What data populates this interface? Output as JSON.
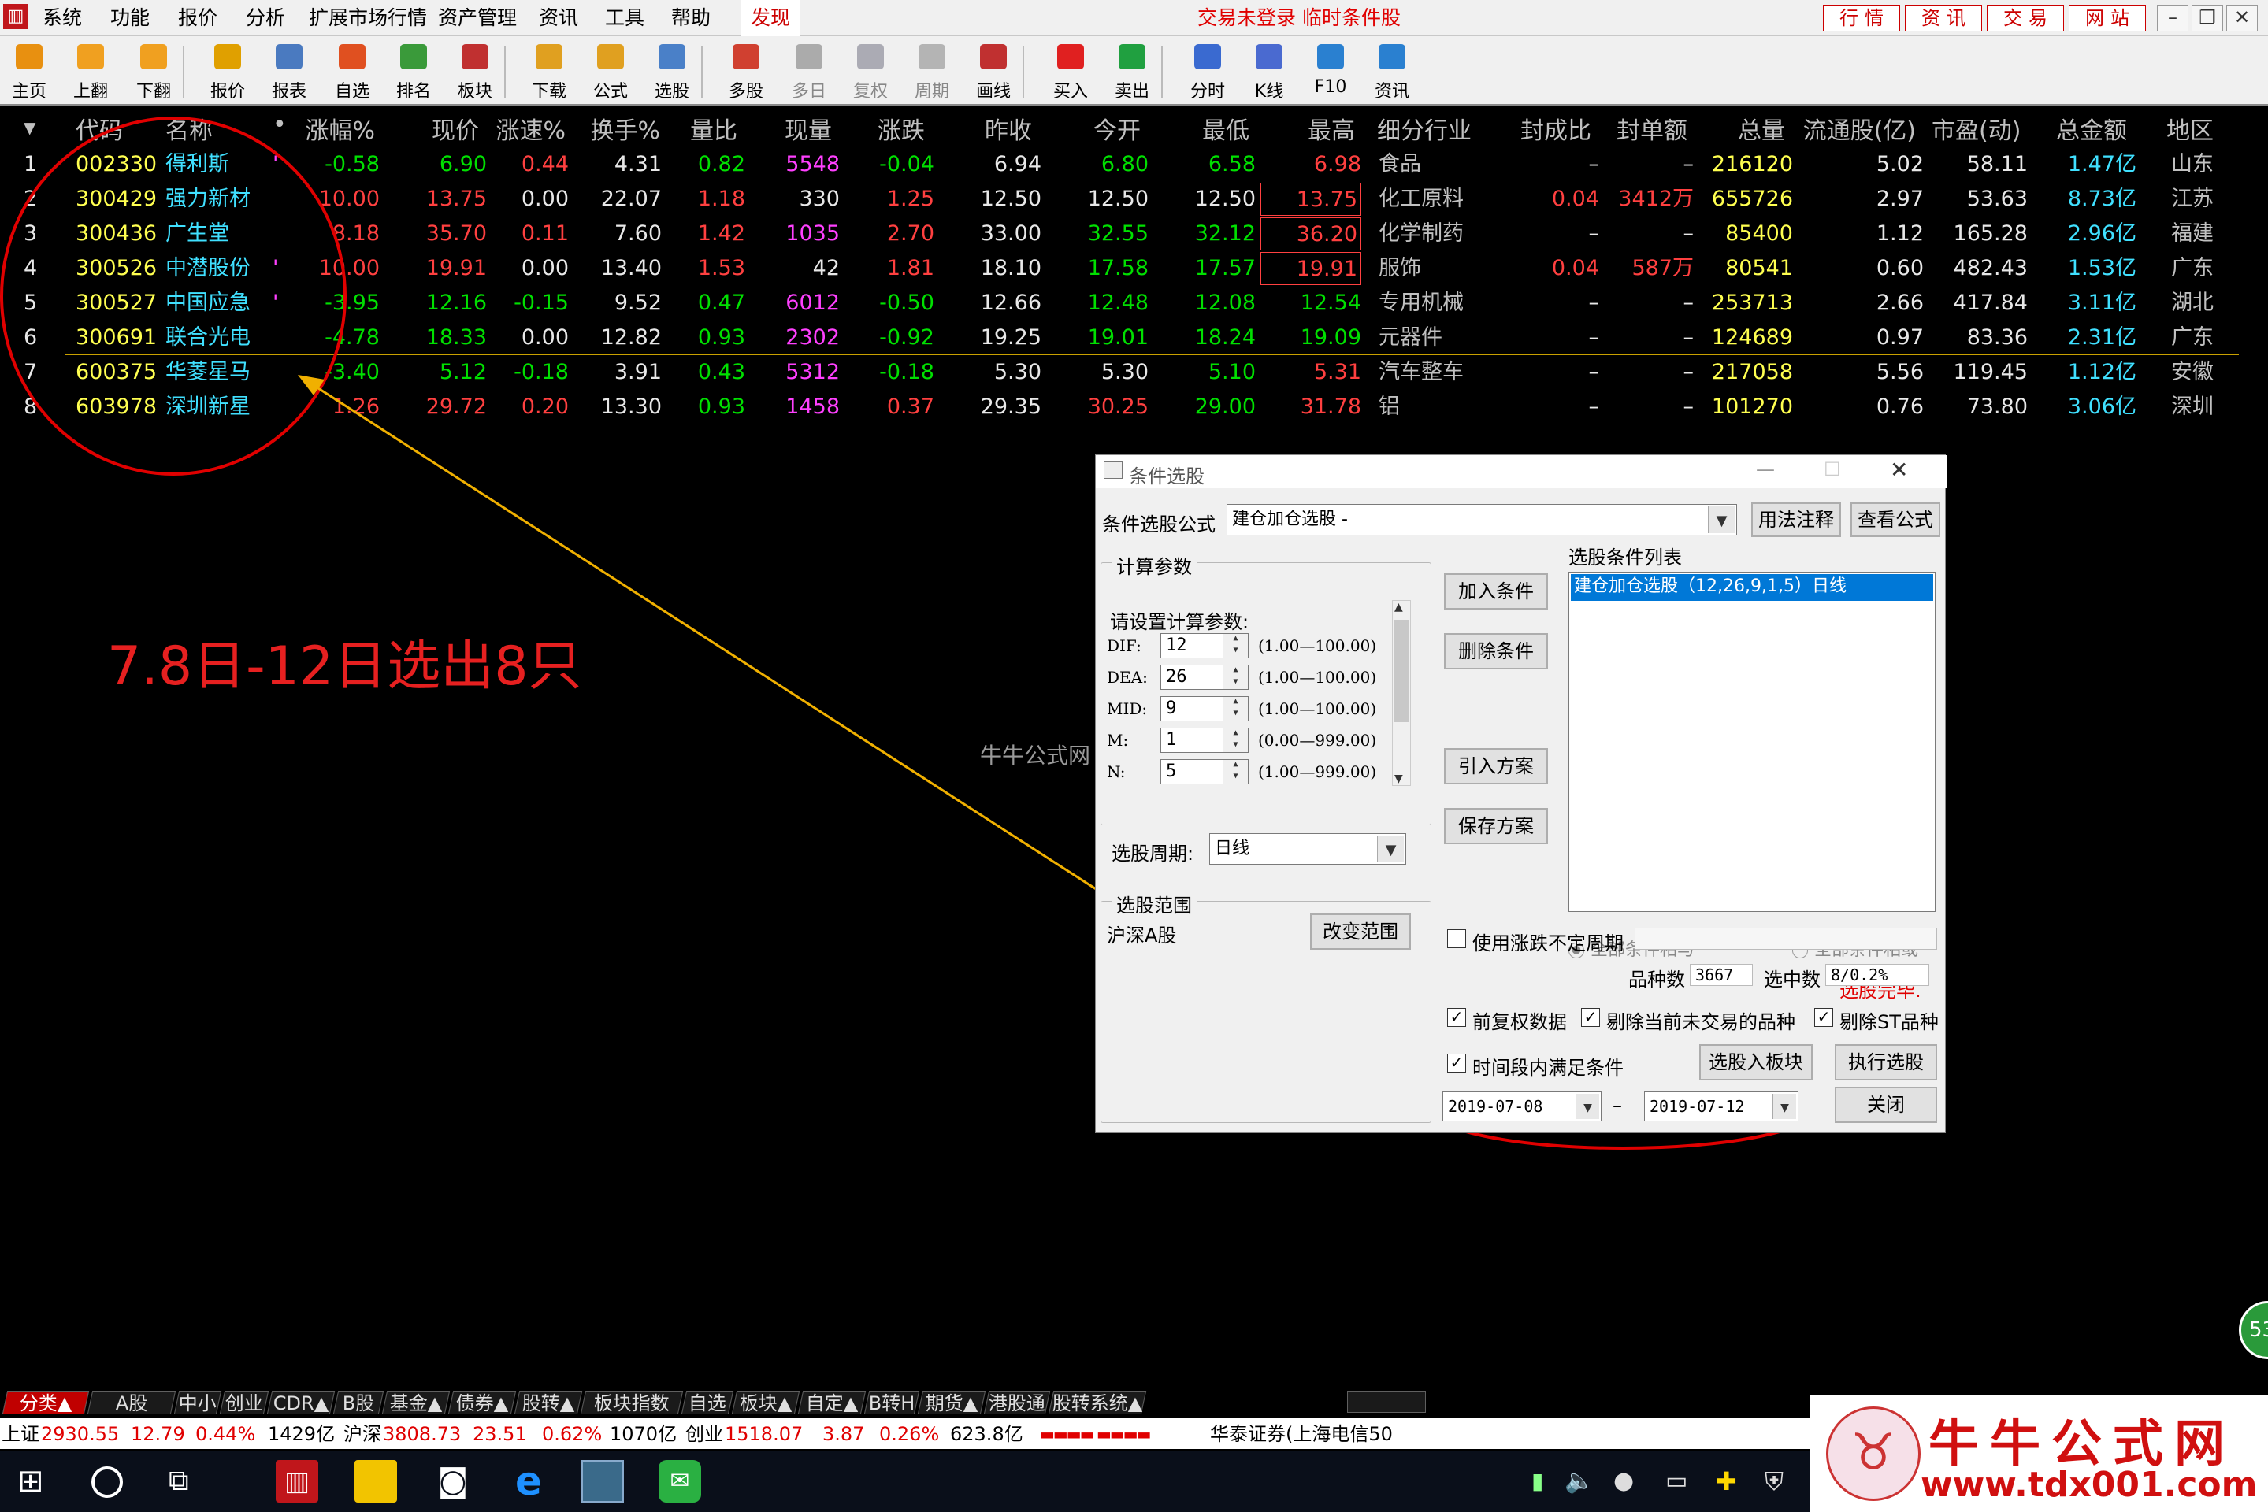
{
  "menu": {
    "items": [
      "系统",
      "功能",
      "报价",
      "分析",
      "扩展市场行情",
      "资产管理",
      "资讯",
      "工具",
      "帮助"
    ],
    "found": "发现",
    "login_status": "交易未登录  临时条件股",
    "toplinks": [
      "行情",
      "资讯",
      "交易",
      "网站"
    ]
  },
  "toolbar": {
    "buttons": [
      {
        "label": "主页",
        "icon": "home-icon"
      },
      {
        "label": "上翻",
        "icon": "page-up-icon"
      },
      {
        "label": "下翻",
        "icon": "page-down-icon"
      },
      {
        "label": "报价",
        "icon": "quote-icon"
      },
      {
        "label": "报表",
        "icon": "report-icon"
      },
      {
        "label": "自选",
        "icon": "watchlist-icon"
      },
      {
        "label": "排名",
        "icon": "ranking-icon"
      },
      {
        "label": "板块",
        "icon": "sector-icon"
      },
      {
        "label": "下载",
        "icon": "download-icon"
      },
      {
        "label": "公式",
        "icon": "formula-icon"
      },
      {
        "label": "选股",
        "icon": "stock-picker-icon"
      },
      {
        "label": "多股",
        "icon": "multi-stock-icon"
      },
      {
        "label": "多日",
        "icon": "multi-day-icon"
      },
      {
        "label": "复权",
        "icon": "adjust-icon"
      },
      {
        "label": "周期",
        "icon": "period-icon"
      },
      {
        "label": "画线",
        "icon": "draw-line-icon"
      },
      {
        "label": "买入",
        "icon": "buy-icon"
      },
      {
        "label": "卖出",
        "icon": "sell-icon"
      },
      {
        "label": "分时",
        "icon": "intraday-icon"
      },
      {
        "label": "K线",
        "icon": "kline-icon"
      },
      {
        "label": "F10",
        "icon": "f10-icon"
      },
      {
        "label": "资讯",
        "icon": "news-icon"
      }
    ]
  },
  "table": {
    "headers": [
      "代码",
      "名称",
      "•",
      "涨幅%",
      "现价",
      "涨速%",
      "换手%",
      "量比",
      "现量",
      "涨跌",
      "昨收",
      "今开",
      "最低",
      "最高",
      "细分行业",
      "封成比",
      "封单额",
      "总量",
      "流通股(亿)",
      "市盈(动)",
      "总金额",
      "地区"
    ],
    "rows": [
      {
        "no": "1",
        "code": "002330",
        "name": "得利斯",
        "dot": "'",
        "pct": "-0.58",
        "price": "6.90",
        "speed": "0.44",
        "turnover": "4.31",
        "vratio": "0.82",
        "vol": "5548",
        "chg": "-0.04",
        "prev": "6.94",
        "open": "6.80",
        "low": "6.58",
        "high": "6.98",
        "industry": "食品",
        "sealratio": "–",
        "sealamt": "–",
        "total": "216120",
        "float": "5.02",
        "pe": "58.11",
        "amount": "1.47亿",
        "region": "山东"
      },
      {
        "no": "2",
        "code": "300429",
        "name": "强力新材",
        "dot": "",
        "pct": "10.00",
        "price": "13.75",
        "speed": "0.00",
        "turnover": "22.07",
        "vratio": "1.18",
        "vol": "330",
        "chg": "1.25",
        "prev": "12.50",
        "open": "12.50",
        "low": "12.50",
        "high": "13.75",
        "industry": "化工原料",
        "sealratio": "0.04",
        "sealamt": "3412万",
        "total": "655726",
        "float": "2.97",
        "pe": "53.63",
        "amount": "8.73亿",
        "region": "江苏"
      },
      {
        "no": "3",
        "code": "300436",
        "name": "广生堂",
        "dot": "",
        "pct": "8.18",
        "price": "35.70",
        "speed": "0.11",
        "turnover": "7.60",
        "vratio": "1.42",
        "vol": "1035",
        "chg": "2.70",
        "prev": "33.00",
        "open": "32.55",
        "low": "32.12",
        "high": "36.20",
        "industry": "化学制药",
        "sealratio": "–",
        "sealamt": "–",
        "total": "85400",
        "float": "1.12",
        "pe": "165.28",
        "amount": "2.96亿",
        "region": "福建"
      },
      {
        "no": "4",
        "code": "300526",
        "name": "中潜股份",
        "dot": "'",
        "pct": "10.00",
        "price": "19.91",
        "speed": "0.00",
        "turnover": "13.40",
        "vratio": "1.53",
        "vol": "42",
        "chg": "1.81",
        "prev": "18.10",
        "open": "17.58",
        "low": "17.57",
        "high": "19.91",
        "industry": "服饰",
        "sealratio": "0.04",
        "sealamt": "587万",
        "total": "80541",
        "float": "0.60",
        "pe": "482.43",
        "amount": "1.53亿",
        "region": "广东"
      },
      {
        "no": "5",
        "code": "300527",
        "name": "中国应急",
        "dot": "'",
        "pct": "-3.95",
        "price": "12.16",
        "speed": "-0.15",
        "turnover": "9.52",
        "vratio": "0.47",
        "vol": "6012",
        "chg": "-0.50",
        "prev": "12.66",
        "open": "12.48",
        "low": "12.08",
        "high": "12.54",
        "industry": "专用机械",
        "sealratio": "–",
        "sealamt": "–",
        "total": "253713",
        "float": "2.66",
        "pe": "417.84",
        "amount": "3.11亿",
        "region": "湖北"
      },
      {
        "no": "6",
        "code": "300691",
        "name": "联合光电",
        "dot": "",
        "pct": "-4.78",
        "price": "18.33",
        "speed": "0.00",
        "turnover": "12.82",
        "vratio": "0.93",
        "vol": "2302",
        "chg": "-0.92",
        "prev": "19.25",
        "open": "19.01",
        "low": "18.24",
        "high": "19.09",
        "industry": "元器件",
        "sealratio": "–",
        "sealamt": "–",
        "total": "124689",
        "float": "0.97",
        "pe": "83.36",
        "amount": "2.31亿",
        "region": "广东"
      },
      {
        "no": "7",
        "code": "600375",
        "name": "华菱星马",
        "dot": "",
        "pct": "-3.40",
        "price": "5.12",
        "speed": "-0.18",
        "turnover": "3.91",
        "vratio": "0.43",
        "vol": "5312",
        "chg": "-0.18",
        "prev": "5.30",
        "open": "5.30",
        "low": "5.10",
        "high": "5.31",
        "industry": "汽车整车",
        "sealratio": "–",
        "sealamt": "–",
        "total": "217058",
        "float": "5.56",
        "pe": "119.45",
        "amount": "1.12亿",
        "region": "安徽"
      },
      {
        "no": "8",
        "code": "603978",
        "name": "深圳新星",
        "dot": "",
        "pct": "1.26",
        "price": "29.72",
        "speed": "0.20",
        "turnover": "13.30",
        "vratio": "0.93",
        "vol": "1458",
        "chg": "0.37",
        "prev": "29.35",
        "open": "30.25",
        "low": "29.00",
        "high": "31.78",
        "industry": "铝",
        "sealratio": "–",
        "sealamt": "–",
        "total": "101270",
        "float": "0.76",
        "pe": "73.80",
        "amount": "3.06亿",
        "region": "深圳"
      }
    ]
  },
  "annotation": {
    "text": "7.8日-12日选出8只"
  },
  "watermark": "牛牛公式网 www.tdx001.com",
  "dialog": {
    "title": "条件选股",
    "formula_label": "条件选股公式",
    "formula_value": "建仓加仓选股 -",
    "usage_btn": "用法注释",
    "view_btn": "查看公式",
    "params_group": "计算参数",
    "params_prompt": "请设置计算参数:",
    "params": [
      {
        "name": "DIF:",
        "value": "12",
        "range": "(1.00—100.00)"
      },
      {
        "name": "DEA:",
        "value": "26",
        "range": "(1.00—100.00)"
      },
      {
        "name": "MID:",
        "value": "9",
        "range": "(1.00—100.00)"
      },
      {
        "name": "M:",
        "value": "1",
        "range": "(0.00—999.00)"
      },
      {
        "name": "N:",
        "value": "5",
        "range": "(1.00—999.00)"
      }
    ],
    "period_label": "选股周期:",
    "period_value": "日线",
    "add_btn": "加入条件",
    "del_btn": "删除条件",
    "import_btn": "引入方案",
    "save_btn": "保存方案",
    "list_label": "选股条件列表",
    "list_item": "建仓加仓选股（12,26,9,1,5）日线",
    "radio_and": "全部条件相与",
    "radio_or": "全部条件相或",
    "done": "选股完毕.",
    "scope_group": "选股范围",
    "scope_value": "沪深A股",
    "scope_btn": "改变范围",
    "use_vol_label": "使用涨跌不定周期",
    "count_label": "品种数",
    "count_value": "3667",
    "selected_label": "选中数",
    "selected_value": "8/0.2%",
    "chk1": "前复权数据",
    "chk2": "剔除当前未交易的品种",
    "chk3": "剔除ST品种",
    "chk4": "时间段内满足条件",
    "to_sector_btn": "选股入板块",
    "run_btn": "执行选股",
    "close_btn": "关闭",
    "date_from": "2019-07-08",
    "date_sep": "–",
    "date_to": "2019-07-12"
  },
  "tabs": [
    "分类▲",
    "A股",
    "中小",
    "创业",
    "CDR▲",
    "B股",
    "基金▲",
    "债券▲",
    "股转▲",
    "板块指数",
    "自选",
    "板块▲",
    "自定▲",
    "B转H",
    "期货▲",
    "港股通",
    "股转系统▲"
  ],
  "status": {
    "sh_label": "上证",
    "sh_val": "2930.55",
    "sh_chg": "12.79",
    "sh_pct": "0.44%",
    "sh_amt": "1429亿",
    "hs_label": "沪深",
    "hs_val": "3808.73",
    "hs_chg": "23.51",
    "hs_pct": "0.62%",
    "hs_amt": "1070亿",
    "cy_label": "创业",
    "cy_val": "1518.07",
    "cy_chg": "3.87",
    "cy_pct": "0.26%",
    "cy_amt": "623.8亿",
    "broker": "华泰证券(上海电信50"
  },
  "badge": "53",
  "logo": {
    "title": "牛牛公式网",
    "url": "www.tdx001.com"
  }
}
